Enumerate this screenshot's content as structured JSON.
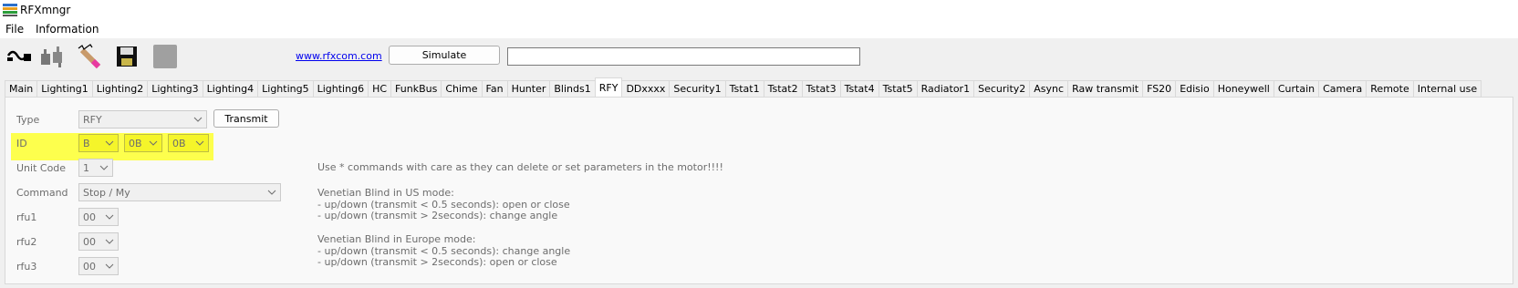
{
  "window": {
    "title": "RFXmngr"
  },
  "menu": {
    "file": "File",
    "information": "Information"
  },
  "toolbar": {
    "link": "www.rfxcom.com",
    "simulate_label": "Simulate",
    "icons": [
      "connect-icon",
      "disconnect-icon",
      "wand-icon",
      "save-icon",
      "blank-icon"
    ]
  },
  "tabs": [
    "Main",
    "Lighting1",
    "Lighting2",
    "Lighting3",
    "Lighting4",
    "Lighting5",
    "Lighting6",
    "HC",
    "FunkBus",
    "Chime",
    "Fan",
    "Hunter",
    "Blinds1",
    "RFY",
    "DDxxxx",
    "Security1",
    "Tstat1",
    "Tstat2",
    "Tstat3",
    "Tstat4",
    "Tstat5",
    "Radiator1",
    "Security2",
    "Async",
    "Raw transmit",
    "FS20",
    "Edisio",
    "Honeywell",
    "Curtain",
    "Camera",
    "Remote",
    "Internal use"
  ],
  "active_tab": "RFY",
  "form": {
    "type_label": "Type",
    "type_value": "RFY",
    "transmit_label": "Transmit",
    "id_label": "ID",
    "id_values": [
      "B",
      "0B",
      "0B"
    ],
    "unit_label": "Unit Code",
    "unit_value": "1",
    "command_label": "Command",
    "command_value": "Stop / My",
    "rfu1_label": "rfu1",
    "rfu1_value": "00",
    "rfu2_label": "rfu2",
    "rfu2_value": "00",
    "rfu3_label": "rfu3",
    "rfu3_value": "00"
  },
  "notes": {
    "warning": "Use * commands with care as they can delete or set parameters in the motor!!!!",
    "us_title": "Venetian Blind in US mode:",
    "us_line1": "- up/down (transmit < 0.5 seconds): open or close",
    "us_line2": "- up/down (transmit > 2seconds): change angle",
    "eu_title": "Venetian Blind in Europe mode:",
    "eu_line1": "- up/down (transmit < 0.5 seconds): change angle",
    "eu_line2": "- up/down (transmit > 2seconds): open or close"
  },
  "colors": {
    "highlight": "#fdff3a",
    "link": "#0000ee"
  }
}
